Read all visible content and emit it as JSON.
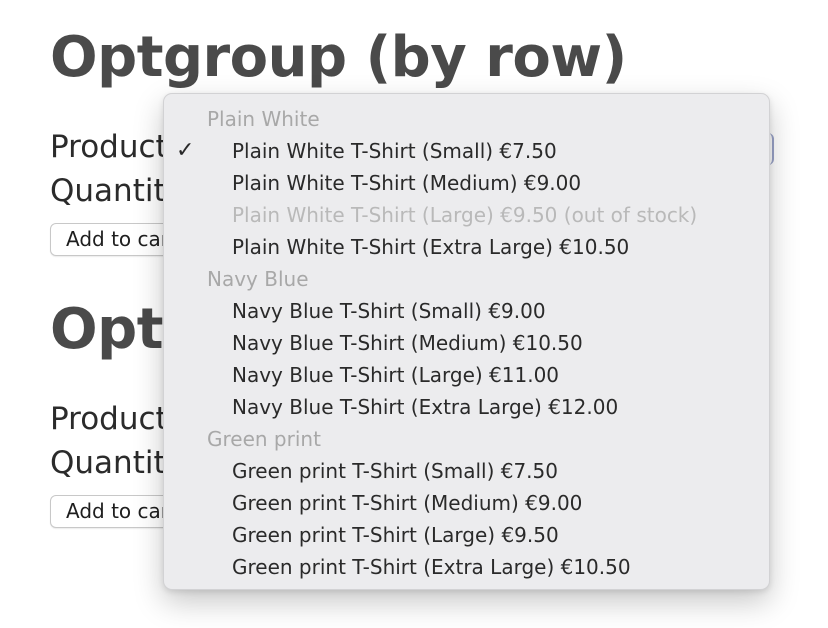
{
  "sections": [
    {
      "heading": "Optgroup (by row)",
      "product_label": "Product",
      "quantity_label": "Quantity",
      "button_label": "Add to cart"
    },
    {
      "heading": "Optgroup (by row)",
      "product_label": "Product",
      "quantity_label": "Quantity",
      "button_label": "Add to cart"
    }
  ],
  "dropdown": {
    "selected": "Plain White T-Shirt (Small) €7.50",
    "check_glyph": "✓",
    "groups": [
      {
        "label": "Plain White",
        "options": [
          {
            "label": "Plain White T-Shirt (Small) €7.50",
            "selected": true,
            "disabled": false
          },
          {
            "label": "Plain White T-Shirt (Medium) €9.00",
            "selected": false,
            "disabled": false
          },
          {
            "label": "Plain White T-Shirt (Large) €9.50 (out of stock)",
            "selected": false,
            "disabled": true
          },
          {
            "label": "Plain White T-Shirt (Extra Large) €10.50",
            "selected": false,
            "disabled": false
          }
        ]
      },
      {
        "label": "Navy Blue",
        "options": [
          {
            "label": "Navy Blue T-Shirt (Small) €9.00",
            "selected": false,
            "disabled": false
          },
          {
            "label": "Navy Blue T-Shirt (Medium) €10.50",
            "selected": false,
            "disabled": false
          },
          {
            "label": "Navy Blue T-Shirt (Large) €11.00",
            "selected": false,
            "disabled": false
          },
          {
            "label": "Navy Blue T-Shirt (Extra Large) €12.00",
            "selected": false,
            "disabled": false
          }
        ]
      },
      {
        "label": "Green print",
        "options": [
          {
            "label": "Green print T-Shirt (Small) €7.50",
            "selected": false,
            "disabled": false
          },
          {
            "label": "Green print T-Shirt (Medium) €9.00",
            "selected": false,
            "disabled": false
          },
          {
            "label": "Green print T-Shirt (Large) €9.50",
            "selected": false,
            "disabled": false
          },
          {
            "label": "Green print T-Shirt (Extra Large) €10.50",
            "selected": false,
            "disabled": false
          }
        ]
      }
    ]
  },
  "colors": {
    "heading": "#4a4a4a",
    "menu_background": "#ececee",
    "group_label": "#a8a8a8",
    "disabled_option": "#b9b9b9",
    "focus_ring": "#9aa3c8"
  }
}
